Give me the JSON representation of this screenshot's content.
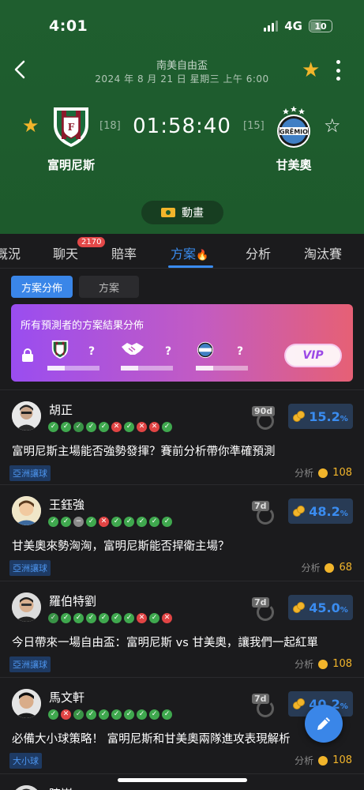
{
  "status_bar": {
    "time": "4:01",
    "network": "4G",
    "battery": "10"
  },
  "match": {
    "league": "南美自由盃",
    "date": "2024 年 8 月 21 日 星期三 上午 6:00",
    "home": {
      "name": "富明尼斯",
      "rank": "[18]"
    },
    "away": {
      "name": "甘美奧",
      "rank": "[15]"
    },
    "timer": "01:58:40",
    "animation_label": "動畫"
  },
  "tabs": [
    {
      "label": "概況"
    },
    {
      "label": "聊天",
      "badge": "2170"
    },
    {
      "label": "賠率"
    },
    {
      "label": "方案"
    },
    {
      "label": "分析"
    },
    {
      "label": "淘汰賽"
    }
  ],
  "subtabs": {
    "distribution": "方案分佈",
    "plans": "方案"
  },
  "vip_card": {
    "title": "所有預測者的方案結果分佈",
    "unknown": "?",
    "button": "VIP"
  },
  "predictors": [
    {
      "name": "胡正",
      "period": "90d",
      "pct": "15.2",
      "pct_unit": "%",
      "headline": "富明尼斯主場能否強勢發揮？賽前分析帶你準確預測",
      "tag": "亞洲讓球",
      "meta_label": "分析",
      "price": "108",
      "record": [
        "w",
        "w",
        "h",
        "w",
        "w",
        "l",
        "w",
        "l",
        "l",
        "w"
      ]
    },
    {
      "name": "王鈺強",
      "period": "7d",
      "pct": "48.2",
      "pct_unit": "%",
      "headline": "甘美奧來勢洶洶，富明尼斯能否捍衛主場？",
      "tag": "亞洲讓球",
      "meta_label": "分析",
      "price": "68",
      "record": [
        "w",
        "w",
        "d",
        "w",
        "l",
        "w",
        "w",
        "w",
        "w",
        "w"
      ]
    },
    {
      "name": "羅伯特劉",
      "period": "7d",
      "pct": "45.0",
      "pct_unit": "%",
      "headline": "今日帶來一場自由盃：富明尼斯 vs 甘美奧，讓我們一起紅單",
      "tag": "亞洲讓球",
      "meta_label": "分析",
      "price": "108",
      "record": [
        "h",
        "w",
        "w",
        "w",
        "w",
        "w",
        "w",
        "l",
        "w",
        "l"
      ]
    },
    {
      "name": "馬文軒",
      "period": "7d",
      "pct": "40.2",
      "pct_unit": "%",
      "headline": "必備大小球策略！ 富明尼斯和甘美奧兩隊進攻表現解析",
      "tag": "大小球",
      "meta_label": "分析",
      "price": "108",
      "record": [
        "w",
        "l",
        "h",
        "w",
        "w",
        "w",
        "w",
        "w",
        "w",
        "w"
      ]
    },
    {
      "name": "陳嵩"
    }
  ],
  "colors": {
    "header_green": "#1f5e2f",
    "accent_blue": "#3a8cf0",
    "gold": "#f2b52b",
    "loss_red": "#e14444",
    "win_green": "#3fa84e"
  }
}
